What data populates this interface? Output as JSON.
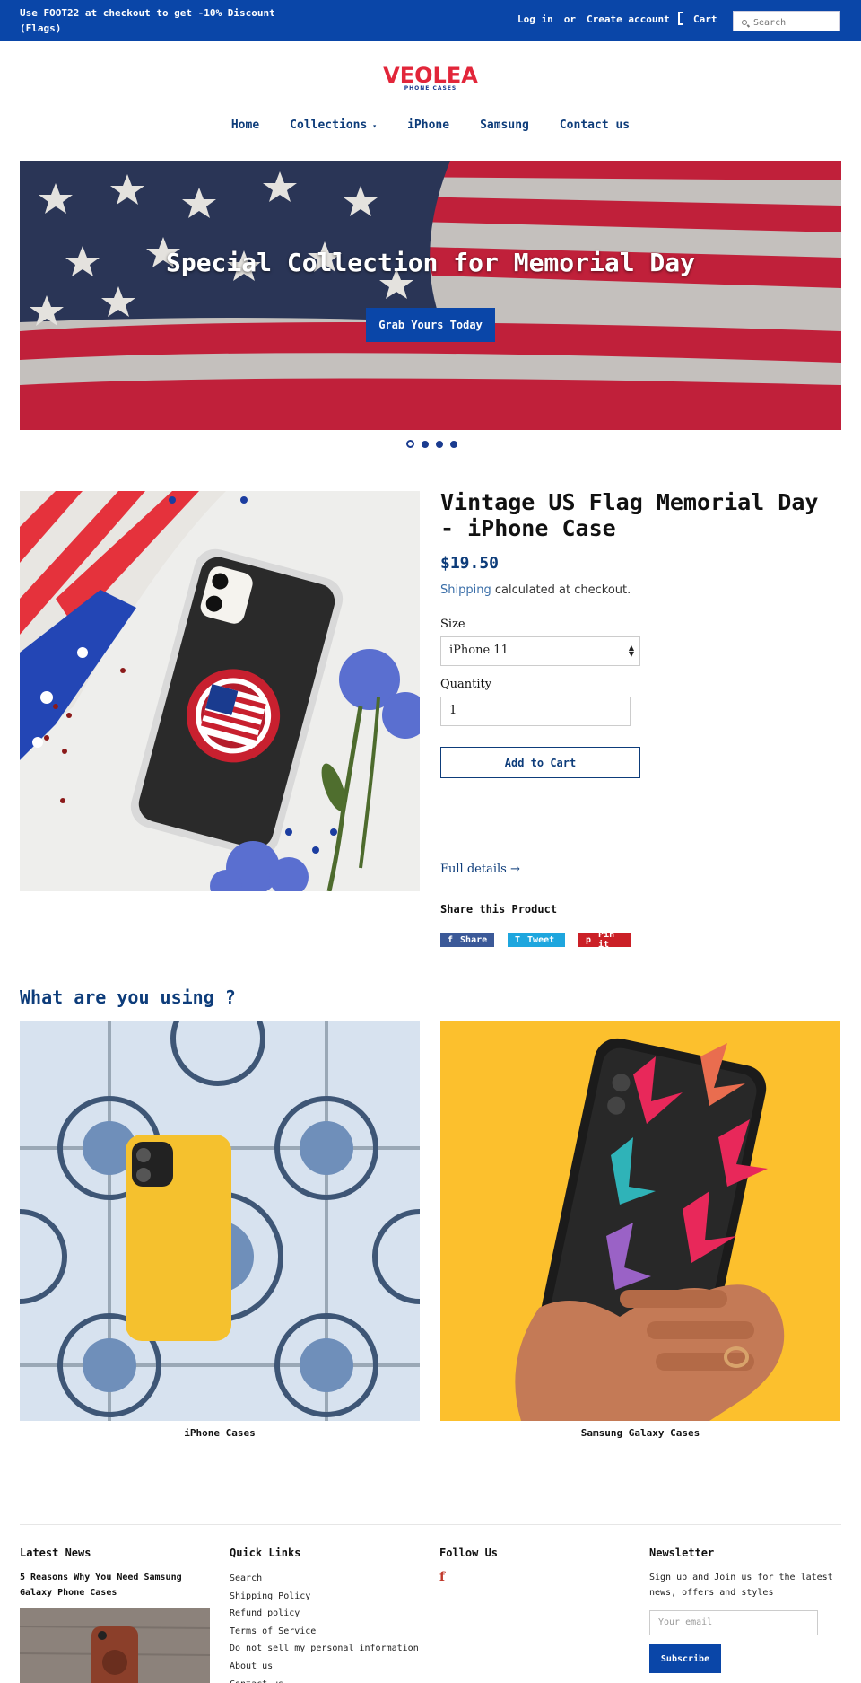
{
  "topbar": {
    "promo": "Use FOOT22 at checkout to get -10% Discount (Flags)",
    "login": "Log in",
    "or": "or",
    "create_account": "Create account",
    "cart": "Cart",
    "search_placeholder": "Search"
  },
  "logo": {
    "word": "VEOLEA",
    "sub": "PHONE CASES"
  },
  "nav": {
    "home": "Home",
    "collections": "Collections",
    "iphone": "iPhone",
    "samsung": "Samsung",
    "contact": "Contact us"
  },
  "hero": {
    "title": "Special Collection for Memorial Day",
    "button": "Grab Yours Today",
    "slides": 4,
    "active_slide": 1
  },
  "product": {
    "title": "Vintage US Flag Memorial Day - iPhone Case",
    "price": "$19.50",
    "shipping_link": "Shipping",
    "shipping_text": "calculated at checkout.",
    "size_label": "Size",
    "size_value": "iPhone 11",
    "quantity_label": "Quantity",
    "quantity_value": "1",
    "add_to_cart": "Add to Cart",
    "full_details": "Full details →",
    "share_heading": "Share this Product",
    "share_facebook": "Share",
    "share_twitter": "Tweet",
    "share_pinterest": "Pin it"
  },
  "collections": {
    "title": "What are you using ?",
    "items": [
      {
        "label": "iPhone Cases"
      },
      {
        "label": "Samsung Galaxy Cases"
      }
    ]
  },
  "footer": {
    "latest_news": {
      "heading": "Latest News",
      "post_title": "5 Reasons Why You Need Samsung Galaxy Phone Cases"
    },
    "quick_links": {
      "heading": "Quick Links",
      "items": [
        "Search",
        "Shipping Policy",
        "Refund policy",
        "Terms of Service",
        "Do not sell my personal information",
        "About us",
        "Contact us"
      ]
    },
    "follow": {
      "heading": "Follow Us",
      "facebook": "f"
    },
    "newsletter": {
      "heading": "Newsletter",
      "text": "Sign up and Join us for the latest news, offers and styles",
      "email_placeholder": "Your email",
      "subscribe": "Subscribe"
    }
  },
  "colors": {
    "brand_blue": "#0a46a8",
    "nav_blue": "#0d3c7a",
    "logo_red": "#e2263a"
  }
}
